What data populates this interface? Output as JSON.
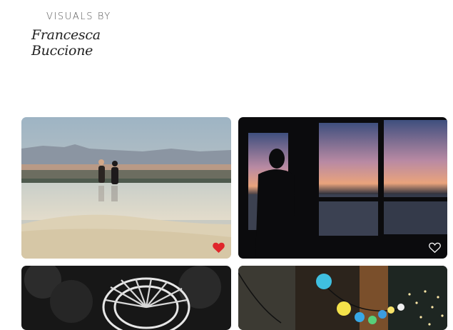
{
  "brand": {
    "line1": "VISUALS BY",
    "signature": "Francesca Buccione"
  },
  "gallery": {
    "items": [
      {
        "subject": "two figures walking on salt flats",
        "liked": true
      },
      {
        "subject": "silhouette at window at sunset",
        "liked": false
      },
      {
        "subject": "ferris wheel in black and white",
        "liked": false
      },
      {
        "subject": "colorful string lights",
        "liked": false
      }
    ],
    "colors": {
      "liked": "#e0262b",
      "unliked": "#ffffff"
    }
  }
}
